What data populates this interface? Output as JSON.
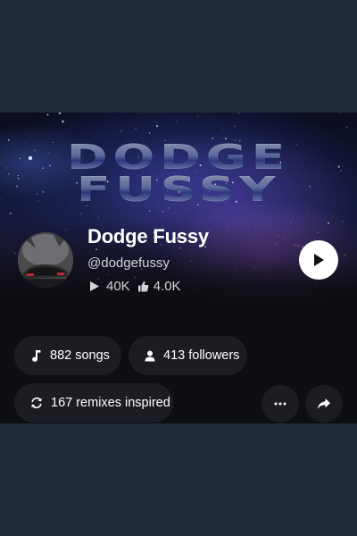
{
  "profile": {
    "banner_logo": {
      "line1": "DODGE",
      "line2": "FUSSY"
    },
    "artist_name": "Dodge Fussy",
    "handle": "@dodgefussy",
    "plays": "40K",
    "likes": "4.0K"
  },
  "pills": {
    "songs": "882 songs",
    "followers": "413 followers",
    "remixes": "167 remixes inspired"
  },
  "icons": {
    "play": "play-icon",
    "like": "thumbs-up-icon",
    "music": "music-note-icon",
    "person": "person-icon",
    "remix": "refresh-icon",
    "more": "more-icon",
    "share": "share-icon"
  },
  "colors": {
    "page_bg": "#1e2a3a",
    "app_bg": "#0d0e12",
    "pill_bg": "#1c1d22",
    "text_primary": "#ffffff",
    "text_secondary": "#d4d4d8"
  }
}
